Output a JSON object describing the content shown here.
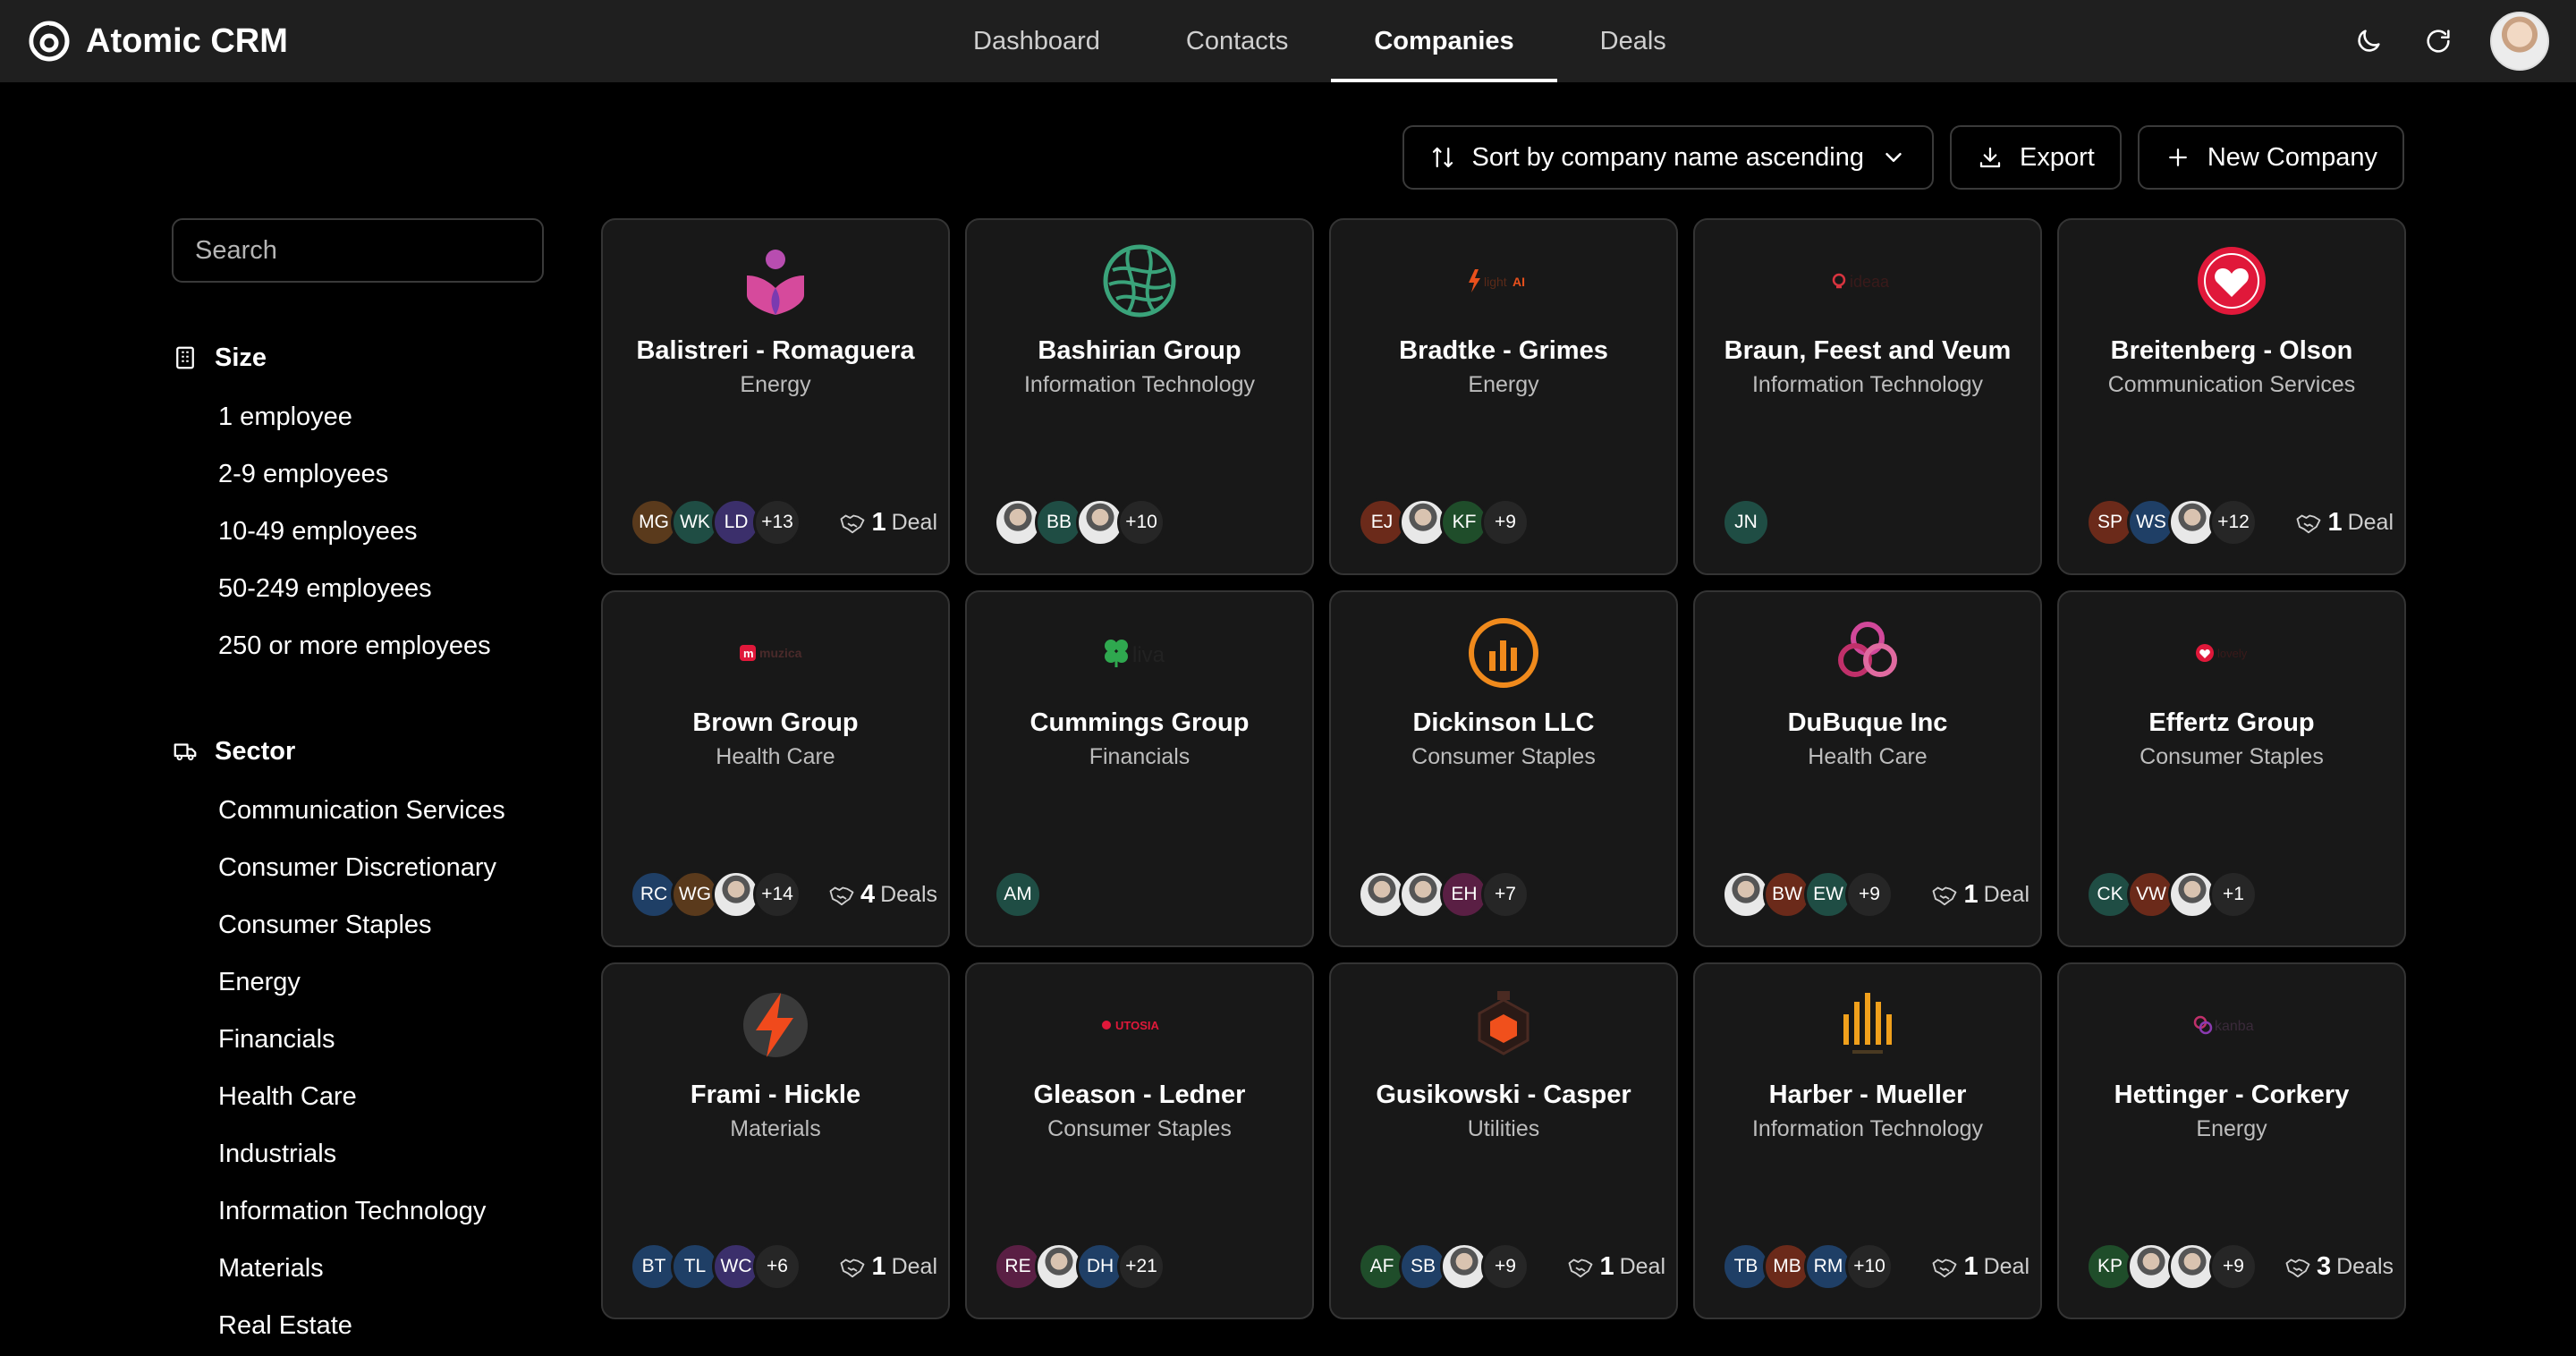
{
  "app": {
    "name": "Atomic CRM"
  },
  "nav": {
    "tabs": [
      "Dashboard",
      "Contacts",
      "Companies",
      "Deals"
    ],
    "active": "Companies"
  },
  "toolbar": {
    "sort_label": "Sort by company name ascending",
    "export_label": "Export",
    "new_label": "New Company"
  },
  "search": {
    "placeholder": "Search"
  },
  "filters": {
    "size": {
      "title": "Size",
      "items": [
        "1 employee",
        "2-9 employees",
        "10-49 employees",
        "50-249 employees",
        "250 or more employees"
      ]
    },
    "sector": {
      "title": "Sector",
      "items": [
        "Communication Services",
        "Consumer Discretionary",
        "Consumer Staples",
        "Energy",
        "Financials",
        "Health Care",
        "Industrials",
        "Information Technology",
        "Materials",
        "Real Estate"
      ]
    }
  },
  "companies": [
    {
      "name": "Balistreri - Romaguera",
      "sector": "Energy",
      "logo_icon": "person-heart-logo",
      "contacts": [
        {
          "i": "MG",
          "c": "#5a3a1c"
        },
        {
          "i": "WK",
          "c": "#1f4d44"
        },
        {
          "i": "LD",
          "c": "#3b2f6b"
        }
      ],
      "more": "+13",
      "deals_count": "1",
      "deals_word": "Deal"
    },
    {
      "name": "Bashirian Group",
      "sector": "Information Technology",
      "logo_icon": "globe-lines-logo",
      "contacts": [
        {
          "i": "",
          "photo": true
        },
        {
          "i": "BB",
          "c": "#1f4d44"
        },
        {
          "i": "",
          "photo": true
        }
      ],
      "more": "+10",
      "deals_count": "",
      "deals_word": ""
    },
    {
      "name": "Bradtke - Grimes",
      "sector": "Energy",
      "logo_icon": "lightai-logo",
      "contacts": [
        {
          "i": "EJ",
          "c": "#6b2a1a"
        },
        {
          "i": "",
          "photo": true
        },
        {
          "i": "KF",
          "c": "#1f4d2a"
        }
      ],
      "more": "+9",
      "deals_count": "",
      "deals_word": ""
    },
    {
      "name": "Braun, Feest and Veum",
      "sector": "Information Technology",
      "logo_icon": "ideaa-logo",
      "contacts": [
        {
          "i": "JN",
          "c": "#1f4d44"
        }
      ],
      "more": "",
      "deals_count": "",
      "deals_word": ""
    },
    {
      "name": "Breitenberg - Olson",
      "sector": "Communication Services",
      "logo_icon": "heart-circle-logo",
      "contacts": [
        {
          "i": "SP",
          "c": "#6b2a1a"
        },
        {
          "i": "WS",
          "c": "#1f3f66"
        },
        {
          "i": "",
          "photo": true
        }
      ],
      "more": "+12",
      "deals_count": "1",
      "deals_word": "Deal"
    },
    {
      "name": "Brown Group",
      "sector": "Health Care",
      "logo_icon": "muzica-logo",
      "contacts": [
        {
          "i": "RC",
          "c": "#1f3f66"
        },
        {
          "i": "WG",
          "c": "#5a3a1c"
        },
        {
          "i": "",
          "photo": true
        }
      ],
      "more": "+14",
      "deals_count": "4",
      "deals_word": "Deals"
    },
    {
      "name": "Cummings Group",
      "sector": "Financials",
      "logo_icon": "clover-liva-logo",
      "contacts": [
        {
          "i": "AM",
          "c": "#1f4d44"
        }
      ],
      "more": "",
      "deals_count": "",
      "deals_word": ""
    },
    {
      "name": "Dickinson LLC",
      "sector": "Consumer Staples",
      "logo_icon": "bars-circle-logo",
      "contacts": [
        {
          "i": "",
          "photo": true
        },
        {
          "i": "",
          "photo": true
        },
        {
          "i": "EH",
          "c": "#5a1f44"
        }
      ],
      "more": "+7",
      "deals_count": "",
      "deals_word": ""
    },
    {
      "name": "DuBuque Inc",
      "sector": "Health Care",
      "logo_icon": "triple-loop-logo",
      "contacts": [
        {
          "i": "",
          "photo": true
        },
        {
          "i": "BW",
          "c": "#6b2a1a"
        },
        {
          "i": "EW",
          "c": "#1f4d44"
        }
      ],
      "more": "+9",
      "deals_count": "1",
      "deals_word": "Deal"
    },
    {
      "name": "Effertz Group",
      "sector": "Consumer Staples",
      "logo_icon": "small-heart-logo",
      "contacts": [
        {
          "i": "CK",
          "c": "#1f4d44"
        },
        {
          "i": "VW",
          "c": "#6b2a1a"
        },
        {
          "i": "",
          "photo": true
        }
      ],
      "more": "+1",
      "deals_count": "",
      "deals_word": ""
    },
    {
      "name": "Frami - Hickle",
      "sector": "Materials",
      "logo_icon": "lightning-logo",
      "contacts": [
        {
          "i": "BT",
          "c": "#1f3f66"
        },
        {
          "i": "TL",
          "c": "#1f3f66"
        },
        {
          "i": "WC",
          "c": "#3b2f6b"
        }
      ],
      "more": "+6",
      "deals_count": "1",
      "deals_word": "Deal"
    },
    {
      "name": "Gleason - Ledner",
      "sector": "Consumer Staples",
      "logo_icon": "utosia-logo",
      "contacts": [
        {
          "i": "RE",
          "c": "#5a1f44"
        },
        {
          "i": "",
          "photo": true
        },
        {
          "i": "DH",
          "c": "#1f3f66"
        }
      ],
      "more": "+21",
      "deals_count": "",
      "deals_word": ""
    },
    {
      "name": "Gusikowski - Casper",
      "sector": "Utilities",
      "logo_icon": "hexagon-flask-logo",
      "contacts": [
        {
          "i": "AF",
          "c": "#1f4d2a"
        },
        {
          "i": "SB",
          "c": "#1f3f66"
        },
        {
          "i": "",
          "photo": true
        }
      ],
      "more": "+9",
      "deals_count": "1",
      "deals_word": "Deal"
    },
    {
      "name": "Harber - Mueller",
      "sector": "Information Technology",
      "logo_icon": "columns-logo",
      "contacts": [
        {
          "i": "TB",
          "c": "#1f3f66"
        },
        {
          "i": "MB",
          "c": "#6b2a1a"
        },
        {
          "i": "RM",
          "c": "#1f3f66"
        }
      ],
      "more": "+10",
      "deals_count": "1",
      "deals_word": "Deal"
    },
    {
      "name": "Hettinger - Corkery",
      "sector": "Energy",
      "logo_icon": "kanba-logo",
      "contacts": [
        {
          "i": "KP",
          "c": "#1f4d2a"
        },
        {
          "i": "",
          "photo": true
        },
        {
          "i": "",
          "photo": true
        }
      ],
      "more": "+9",
      "deals_count": "3",
      "deals_word": "Deals"
    }
  ]
}
